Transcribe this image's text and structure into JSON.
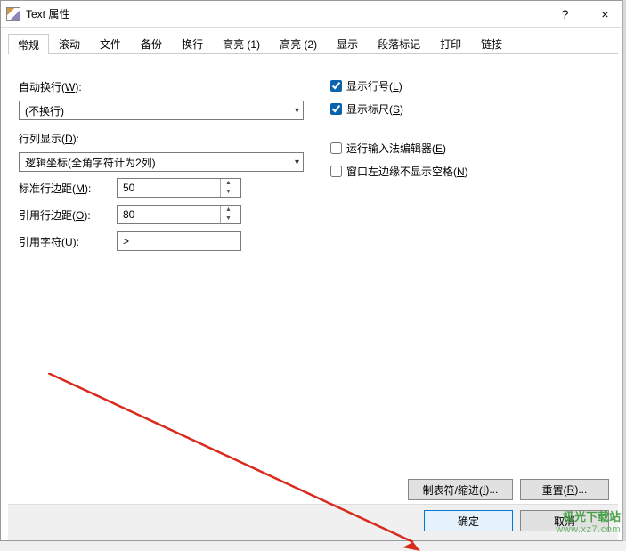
{
  "window": {
    "title": "Text 属性",
    "help": "?",
    "close": "×"
  },
  "tabs": [
    {
      "label": "常规"
    },
    {
      "label": "滚动"
    },
    {
      "label": "文件"
    },
    {
      "label": "备份"
    },
    {
      "label": "换行"
    },
    {
      "label": "高亮 (1)"
    },
    {
      "label": "高亮 (2)"
    },
    {
      "label": "显示"
    },
    {
      "label": "段落标记"
    },
    {
      "label": "打印"
    },
    {
      "label": "链接"
    }
  ],
  "activeTab": 0,
  "left": {
    "autowrap_label": "自动换行(",
    "autowrap_key": "W",
    "autowrap_suffix": "):",
    "autowrap_value": "(不换行)",
    "rowdisp_label": "行列显示(",
    "rowdisp_key": "D",
    "rowdisp_suffix": "):",
    "rowdisp_value": "逻辑坐标(全角字符计为2列)",
    "stdmargin_label": "标准行边距(",
    "stdmargin_key": "M",
    "stdmargin_suffix": "):",
    "stdmargin_value": "50",
    "quotmargin_label": "引用行边距(",
    "quotmargin_key": "O",
    "quotmargin_suffix": "):",
    "quotmargin_value": "80",
    "quotechar_label": "引用字符(",
    "quotechar_key": "U",
    "quotechar_suffix": "):",
    "quotechar_value": ">"
  },
  "right": {
    "linenum_label": "显示行号(",
    "linenum_key": "L",
    "linenum_suffix": ")",
    "ruler_label": "显示标尺(",
    "ruler_key": "S",
    "ruler_suffix": ")",
    "ime_label": "运行输入法编辑器(",
    "ime_key": "E",
    "ime_suffix": ")",
    "nospaces_label": "窗口左边缘不显示空格(",
    "nospaces_key": "N",
    "nospaces_suffix": ")"
  },
  "buttons": {
    "tabs_indent": "制表符/缩进(",
    "tabs_indent_key": "I",
    "tabs_indent_suffix": ")...",
    "reset": "重置(",
    "reset_key": "R",
    "reset_suffix": ")...",
    "ok": "确定",
    "cancel": "取消"
  },
  "watermark": {
    "line1": "极光下载站",
    "line2": "www.xz7.com"
  },
  "colors": {
    "accent": "#0078d7",
    "arrow": "#d92a1c"
  }
}
